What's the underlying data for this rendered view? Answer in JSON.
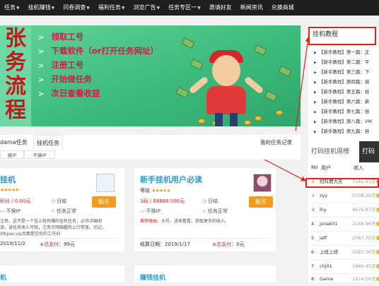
{
  "nav": {
    "items": [
      {
        "label": "任务",
        "dropdown": true
      },
      {
        "label": "挂机赚钱",
        "dropdown": true
      },
      {
        "label": "问卷调查",
        "dropdown": true
      },
      {
        "label": "福利任务",
        "dropdown": true
      },
      {
        "label": "浏览广告",
        "dropdown": true
      },
      {
        "label": "任务专区一",
        "dropdown": true
      },
      {
        "label": "邀请好友",
        "dropdown": false
      },
      {
        "label": "新闻资讯",
        "dropdown": false
      },
      {
        "label": "兑换商城",
        "dropdown": false
      }
    ]
  },
  "banner": {
    "calligraphy": [
      "张",
      "务",
      "流",
      "程"
    ],
    "steps": [
      "领取工号",
      "下载软件（or打开任务网址）",
      "注册工号",
      "开始做任务",
      "次日查看收益"
    ]
  },
  "sidebar": {
    "title": "挂机教程",
    "items": [
      "【新手教程】第一篇：正",
      "【新手教程】第二篇：平",
      "【新手教程】第三篇：下",
      "【新手教程】第四篇：挂",
      "【新手教程】第五篇：挂",
      "【新手教程】第六篇：新",
      "【新手教程】第七篇：挂",
      "【新手教程】第八篇：VM",
      "【新手教程】第九篇：挂"
    ]
  },
  "ranking": {
    "tab_inactive": "打码挂机周榜",
    "tab_active": "打码",
    "col_no": "No",
    "col_user": "用户",
    "col_income": "收入",
    "rows": [
      {
        "no": "",
        "user": "妇科费大夫",
        "amount": "7182.93万"
      },
      {
        "no": "",
        "user": "zyy",
        "amount": "5708.28万"
      },
      {
        "no": "",
        "user": "lhy",
        "amount": "4676.97万"
      },
      {
        "no": "4",
        "user": "jsnak01",
        "amount": "2148.96万"
      },
      {
        "no": "5",
        "user": "jaff",
        "amount": "2087.70万"
      },
      {
        "no": "6",
        "user": "上班上班",
        "amount": "2087.36万"
      },
      {
        "no": "7",
        "user": "chj01",
        "amount": "1884.45万"
      },
      {
        "no": "8",
        "user": "Game",
        "amount": "1524.56万"
      }
    ]
  },
  "tabs": {
    "tab1": "dama任务",
    "tab2": "挂机任务",
    "record": "我的任务记录",
    "filter1": "换IP",
    "filter2": "不换IP"
  },
  "card1": {
    "title": "挂机",
    "level_stars": "★★★★★",
    "reward": "积分 / 0.00元",
    "freq": "日结",
    "ip": "不换IP",
    "status": "任务正常",
    "desc1": "注意，这不是一个挂上就有赚的挂机任务，必须详细阅",
    "desc2": "读。该任务收入可观，注意点明细趣和上行带宽。切记，",
    "desc3": "iltbjiao.vip页面提交你的工号ID",
    "settle_date": "2019/11/2",
    "total_label": "总支付",
    "total_value": "：99元",
    "enroll": "报名"
  },
  "card2": {
    "title": "新手挂机用户必读",
    "level_label": "等级",
    "level_stars": "★★★★★",
    "reward": "1码 / 88888.000元",
    "freq": "日结",
    "ip": "不换IP",
    "status": "任务正常",
    "desc_label": "推荐理由",
    "desc_text": "：大号，进来看看，获取更多的收入。",
    "settle_label": "结算日期",
    "settle_date": "：2019/1/17",
    "total_label": "总支付",
    "total_value": "：0元",
    "enroll": "报名"
  },
  "bottom": {
    "card3_title": "机",
    "card4_title": "赚钱挂机"
  }
}
